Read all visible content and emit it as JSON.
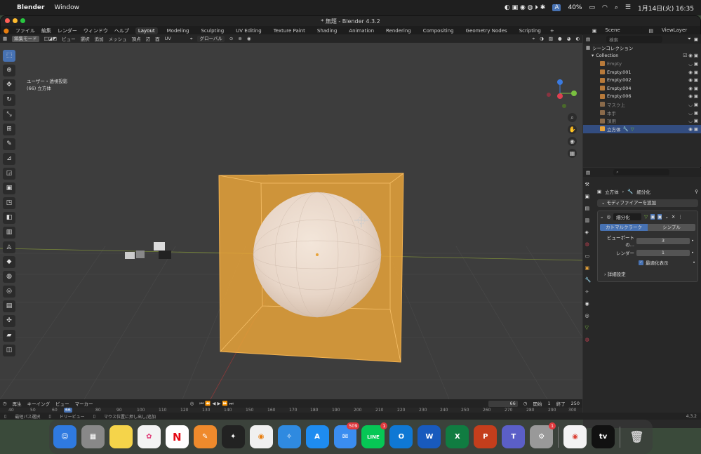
{
  "menubar": {
    "app": "Blender",
    "window": "Window",
    "battery": "40%",
    "clock": "1月14日(火) 16:35",
    "input_mode": "A"
  },
  "title": "* 無題 - Blender 4.3.2",
  "topmenu": {
    "items": [
      "ファイル",
      "編集",
      "レンダー",
      "ウィンドウ",
      "ヘルプ"
    ],
    "workspaces": [
      "Layout",
      "Modeling",
      "Sculpting",
      "UV Editing",
      "Texture Paint",
      "Shading",
      "Animation",
      "Rendering",
      "Compositing",
      "Geometry Nodes",
      "Scripting"
    ],
    "scene": "Scene",
    "viewlayer": "ViewLayer"
  },
  "vp_header": {
    "mode": "編集モード",
    "menus": [
      "ビュー",
      "選択",
      "追加",
      "メッシュ",
      "頂点",
      "辺",
      "面",
      "UV"
    ],
    "orient": "グローバル",
    "options": "オプション",
    "axes": [
      "X",
      "Y",
      "Z"
    ]
  },
  "viewport": {
    "persp": "ユーザー・透視投影",
    "object": "(66) 立方体"
  },
  "outliner": {
    "search": "検索",
    "root": "シーンコレクション",
    "collection": "Collection",
    "items": [
      {
        "name": "Empty",
        "dim": true
      },
      {
        "name": "Empty.001",
        "dim": false
      },
      {
        "name": "Empty.002",
        "dim": false
      },
      {
        "name": "Empty.004",
        "dim": false
      },
      {
        "name": "Empty.006",
        "dim": false
      },
      {
        "name": "マスク上",
        "dim": true
      },
      {
        "name": "本手",
        "dim": true
      },
      {
        "name": "頂用",
        "dim": true
      },
      {
        "name": "立方体",
        "dim": false,
        "selected": true
      }
    ]
  },
  "properties": {
    "search": "",
    "breadcrumb_obj": "立方体",
    "breadcrumb_mod": "細分化",
    "add_modifier": "モディファイアーを追加",
    "modifier_name": "細分化",
    "tab_catmull": "カトマルクラーク",
    "tab_simple": "シンプル",
    "viewport_label": "ビューポートの...",
    "viewport_val": "3",
    "render_label": "レンダー",
    "render_val": "1",
    "optimal": "最適化表示",
    "advanced": "詳細設定"
  },
  "timeline": {
    "playback": "再生",
    "keying": "キーイング",
    "view": "ビュー",
    "marker": "マーカー",
    "current": "66",
    "start_label": "開始",
    "start": "1",
    "end_label": "終了",
    "end": "250",
    "ticks": [
      "40",
      "50",
      "60",
      "66",
      "80",
      "90",
      "100",
      "110",
      "120",
      "130",
      "140",
      "150",
      "160",
      "170",
      "180",
      "190",
      "200",
      "210",
      "220",
      "230",
      "240",
      "250",
      "260",
      "270",
      "280",
      "290",
      "300"
    ]
  },
  "status": {
    "select": "最短パス選択",
    "dolly": "ドリービュー",
    "extrude": "マウス位置に押し出し/追加",
    "version": "4.3.2"
  },
  "dock": {
    "items": [
      "Finder",
      "Launchpad",
      "Notes",
      "Photos",
      "Netflix",
      "Pages",
      "Final Cut",
      "Blender",
      "Safari",
      "App Store",
      "Mail",
      "LINE",
      "Outlook",
      "Word",
      "Excel",
      "PowerPoint",
      "Teams",
      "Settings",
      "Chrome",
      "TV",
      "Trash"
    ],
    "mail_badge": "509",
    "line_badge": "1",
    "settings_badge": "1",
    "tv_label": "tv"
  },
  "colors": {
    "accent": "#4772b3",
    "cube": "#e8a33a",
    "sphere": "#e8d6c8"
  }
}
